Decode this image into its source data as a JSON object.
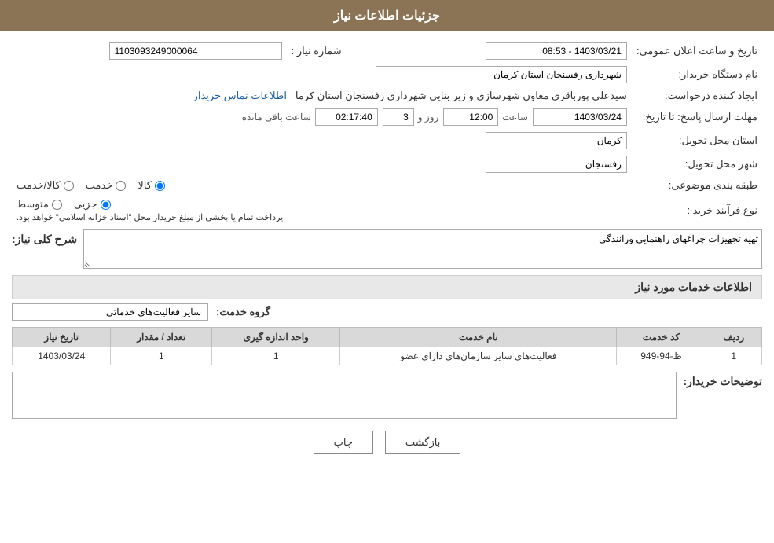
{
  "header": {
    "title": "جزئیات اطلاعات نیاز"
  },
  "fields": {
    "need_number_label": "شماره نیاز :",
    "need_number_value": "1103093249000064",
    "org_name_label": "نام دستگاه خریدار:",
    "org_name_value": "شهرداری رفسنجان استان کرمان",
    "creator_label": "ایجاد کننده درخواست:",
    "creator_value": "سیدعلی پورباقری معاون شهرسازی و زیر بنایی شهرداری رفسنجان استان کرما",
    "creator_link": "اطلاعات تماس خریدار",
    "deadline_label": "مهلت ارسال پاسخ: تا تاریخ:",
    "deadline_date": "1403/03/24",
    "deadline_time": "12:00",
    "deadline_days": "3",
    "deadline_remain": "02:17:40",
    "announce_label": "تاریخ و ساعت اعلان عمومی:",
    "announce_value": "1403/03/21 - 08:53",
    "province_label": "استان محل تحویل:",
    "province_value": "کرمان",
    "city_label": "شهر محل تحویل:",
    "city_value": "رفسنجان",
    "category_label": "طبقه بندی موضوعی:",
    "category_kala": "کالا",
    "category_khadamat": "خدمت",
    "category_kala_khadamat": "کالا/خدمت",
    "process_label": "نوع فرآیند خرید :",
    "process_jazzi": "جزیی",
    "process_motavaset": "متوسط",
    "process_note": "پرداخت تمام یا بخشی از مبلغ خریداز محل \"اسناد خزانه اسلامی\" خواهد بود.",
    "description_label": "شرح کلی نیاز:",
    "description_value": "تهیه تجهیزات چراغهای راهنمایی ورانندگی"
  },
  "services": {
    "title": "اطلاعات خدمات مورد نیاز",
    "group_label": "گروه خدمت:",
    "group_value": "سایر فعالیت‌های خدماتی",
    "table": {
      "headers": [
        "ردیف",
        "کد خدمت",
        "نام خدمت",
        "واحد اندازه گیری",
        "تعداد / مقدار",
        "تاریخ نیاز"
      ],
      "rows": [
        {
          "row": "1",
          "code": "ظ-94-949",
          "name": "فعالیت‌های سایر سازمان‌های دارای عضو",
          "unit": "1",
          "quantity": "1",
          "date": "1403/03/24"
        }
      ]
    }
  },
  "buyer_notes": {
    "label": "توضیحات خریدار:"
  },
  "buttons": {
    "print": "چاپ",
    "back": "بازگشت"
  }
}
